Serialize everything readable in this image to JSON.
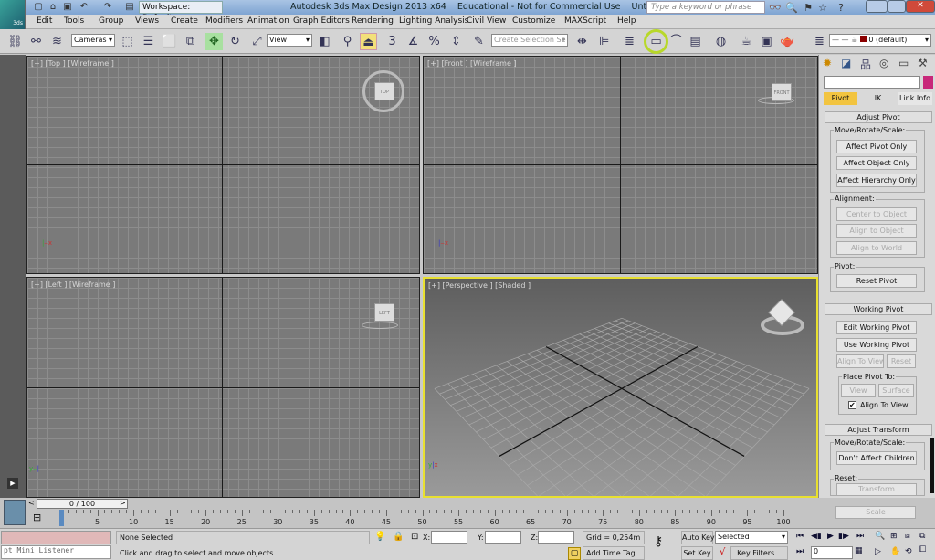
{
  "app": {
    "title": "Autodesk 3ds Max Design 2013 x64    Educational - Not for Commercial Use    Untitled",
    "logo_text": "3ds",
    "workspace": "Workspace: Default",
    "search_placeholder": "Type a keyword or phrase"
  },
  "menu": [
    "Edit",
    "Tools",
    "Group",
    "Views",
    "Create",
    "Modifiers",
    "Animation",
    "Graph Editors",
    "Rendering",
    "Lighting Analysis",
    "Civil View",
    "Customize",
    "MAXScript",
    "Help"
  ],
  "toolbar": {
    "selection_filter": "Cameras",
    "ref_coord": "View",
    "snap_angle": "3",
    "selection_set_placeholder": "Create Selection Se",
    "layer": "0 (default)",
    "highlighted_tool": "rendered-frame-window-icon",
    "highlight_color": "#b8d82a"
  },
  "viewports": [
    {
      "label": "[+] [Top ] [Wireframe ]",
      "cube": "TOP"
    },
    {
      "label": "[+] [Front ] [Wireframe ]",
      "cube": "FRONT"
    },
    {
      "label": "[+] [Left ] [Wireframe ]",
      "cube": "LEFT"
    },
    {
      "label": "[+] [Perspective ] [Shaded ]",
      "active": true,
      "active_color": "#e8e030"
    }
  ],
  "command_panel": {
    "tabs": [
      "Pivot",
      "IK",
      "Link Info"
    ],
    "active_tab": "Pivot",
    "adjust_pivot": {
      "title": "Adjust Pivot",
      "move_group": "Move/Rotate/Scale:",
      "buttons": [
        "Affect Pivot Only",
        "Affect Object Only",
        "Affect Hierarchy Only"
      ],
      "alignment_group": "Alignment:",
      "alignment_buttons": [
        "Center to Object",
        "Align to Object",
        "Align to World"
      ],
      "pivot_group": "Pivot:",
      "reset": "Reset Pivot"
    },
    "working_pivot": {
      "title": "Working Pivot",
      "edit": "Edit Working Pivot",
      "use": "Use Working Pivot",
      "align_view": "Align To View",
      "reset": "Reset",
      "place_group": "Place Pivot To:",
      "view": "View",
      "surface": "Surface",
      "align_checkbox": "Align To View",
      "align_checked": true
    },
    "adjust_transform": {
      "title": "Adjust Transform",
      "move_group": "Move/Rotate/Scale:",
      "dont_affect": "Don't Affect Children",
      "reset_group": "Reset:",
      "transform": "Transform",
      "scale": "Scale"
    },
    "color_swatch": "#c8287a"
  },
  "timeline": {
    "slider": "0 / 100",
    "prev": "<",
    "next": ">",
    "ticks": [
      "0",
      "5",
      "10",
      "15",
      "20",
      "25",
      "30",
      "35",
      "40",
      "45",
      "50",
      "55",
      "60",
      "65",
      "70",
      "75",
      "80",
      "85",
      "90",
      "95",
      "100"
    ]
  },
  "status": {
    "listener": "pt Mini Listener",
    "selection": "None Selected",
    "prompt": "Click and drag to select and move objects",
    "x": "X:",
    "y": "Y:",
    "z": "Z:",
    "grid": "Grid = 0,254m",
    "add_time_tag": "Add Time Tag",
    "auto_key": "Auto Key",
    "set_key": "Set Key",
    "key_mode": "Selected",
    "key_filters": "Key Filters...",
    "frame": "0"
  }
}
